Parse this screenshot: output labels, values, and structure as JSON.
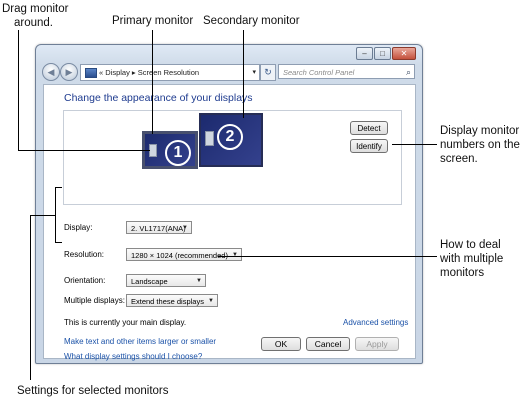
{
  "callouts": {
    "drag_monitor": [
      "Drag monitor",
      "around."
    ],
    "primary_monitor": "Primary monitor",
    "secondary_monitor": "Secondary monitor",
    "display_numbers": [
      "Display monitor",
      "numbers on the",
      "screen."
    ],
    "multiple_monitors": [
      "How to deal",
      "with multiple",
      "monitors"
    ],
    "settings_selected": "Settings for selected monitors"
  },
  "window": {
    "titlebar_buttons": [
      "minimize-icon",
      "maximize-icon",
      "close-icon"
    ],
    "nav": {
      "breadcrumb": "« Display ▸ Screen Resolution",
      "search_placeholder": "Search Control Panel"
    },
    "heading": "Change the appearance of your displays",
    "monitors": [
      {
        "number": "1",
        "role": "primary"
      },
      {
        "number": "2",
        "role": "secondary"
      }
    ],
    "buttons": {
      "detect": "Detect",
      "identify": "Identify"
    },
    "settings": {
      "display_label": "Display:",
      "display_value": "2. VL1717(ANA)",
      "resolution_label": "Resolution:",
      "resolution_value": "1280 × 1024 (recommended)",
      "orientation_label": "Orientation:",
      "orientation_value": "Landscape",
      "multiple_label": "Multiple displays:",
      "multiple_value": "Extend these displays"
    },
    "main_display_note": "This is currently your main display.",
    "advanced_link": "Advanced settings",
    "links": [
      "Make text and other items larger or smaller",
      "What display settings should I choose?"
    ],
    "footer": {
      "ok": "OK",
      "cancel": "Cancel",
      "apply": "Apply"
    }
  },
  "colors": {
    "heading": "#1e3b8f",
    "link": "#1b52a8",
    "monitor_fill": "#2a357c"
  }
}
